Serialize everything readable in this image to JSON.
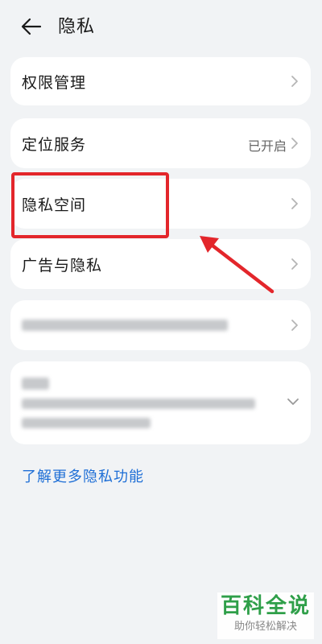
{
  "header": {
    "title": "隐私"
  },
  "items": [
    {
      "label": "权限管理",
      "value": ""
    },
    {
      "label": "定位服务",
      "value": "已开启"
    },
    {
      "label": "隐私空间",
      "value": ""
    },
    {
      "label": "广告与隐私",
      "value": ""
    }
  ],
  "link": {
    "text": "了解更多隐私功能"
  },
  "watermark": {
    "title": "百科全说",
    "subtitle": "助你轻松解决"
  },
  "colors": {
    "accent": "#1f6fd6",
    "highlight": "#e3262b",
    "watermark": "#2f9f49"
  },
  "icons": {
    "back": "arrow-left-icon",
    "chevron": "chevron-right-icon",
    "expand": "chevron-down-icon"
  }
}
